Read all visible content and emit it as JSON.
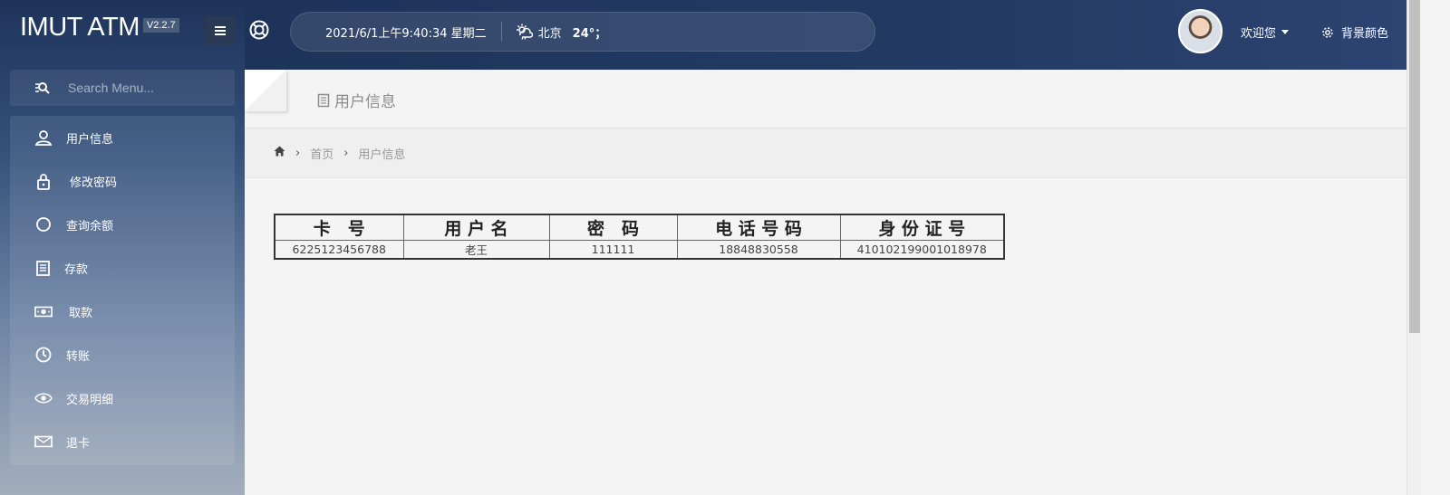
{
  "app": {
    "title": "IMUT ATM",
    "version": "V2.2.7"
  },
  "search": {
    "placeholder": "Search Menu..."
  },
  "sidebar": {
    "items": [
      {
        "label": "用户信息",
        "icon": "user-icon"
      },
      {
        "label": "修改密码",
        "icon": "lock-icon"
      },
      {
        "label": "查询余额",
        "icon": "circle-icon"
      },
      {
        "label": "存款",
        "icon": "document-icon"
      },
      {
        "label": "取款",
        "icon": "money-icon"
      },
      {
        "label": "转账",
        "icon": "clock-icon"
      },
      {
        "label": "交易明细",
        "icon": "eye-icon"
      },
      {
        "label": "退卡",
        "icon": "envelope-icon"
      }
    ]
  },
  "header": {
    "datetime": "2021/6/1上午9:40:34 星期二",
    "city": "北京",
    "temperature": "24°；",
    "welcome": "欢迎您",
    "bg_color_label": "背景颜色"
  },
  "page": {
    "title": "用户信息",
    "breadcrumb": [
      "首页",
      "用户信息"
    ]
  },
  "table": {
    "headers": [
      "卡　号",
      "用 户 名",
      "密　码",
      "电 话 号 码",
      "身 份 证 号"
    ],
    "rows": [
      [
        "6225123456788",
        "老王",
        "111111",
        "18848830558",
        "410102199001018978"
      ]
    ]
  },
  "colors": {
    "topbar": "#1e335a",
    "content_bg": "#f4f4f4"
  }
}
